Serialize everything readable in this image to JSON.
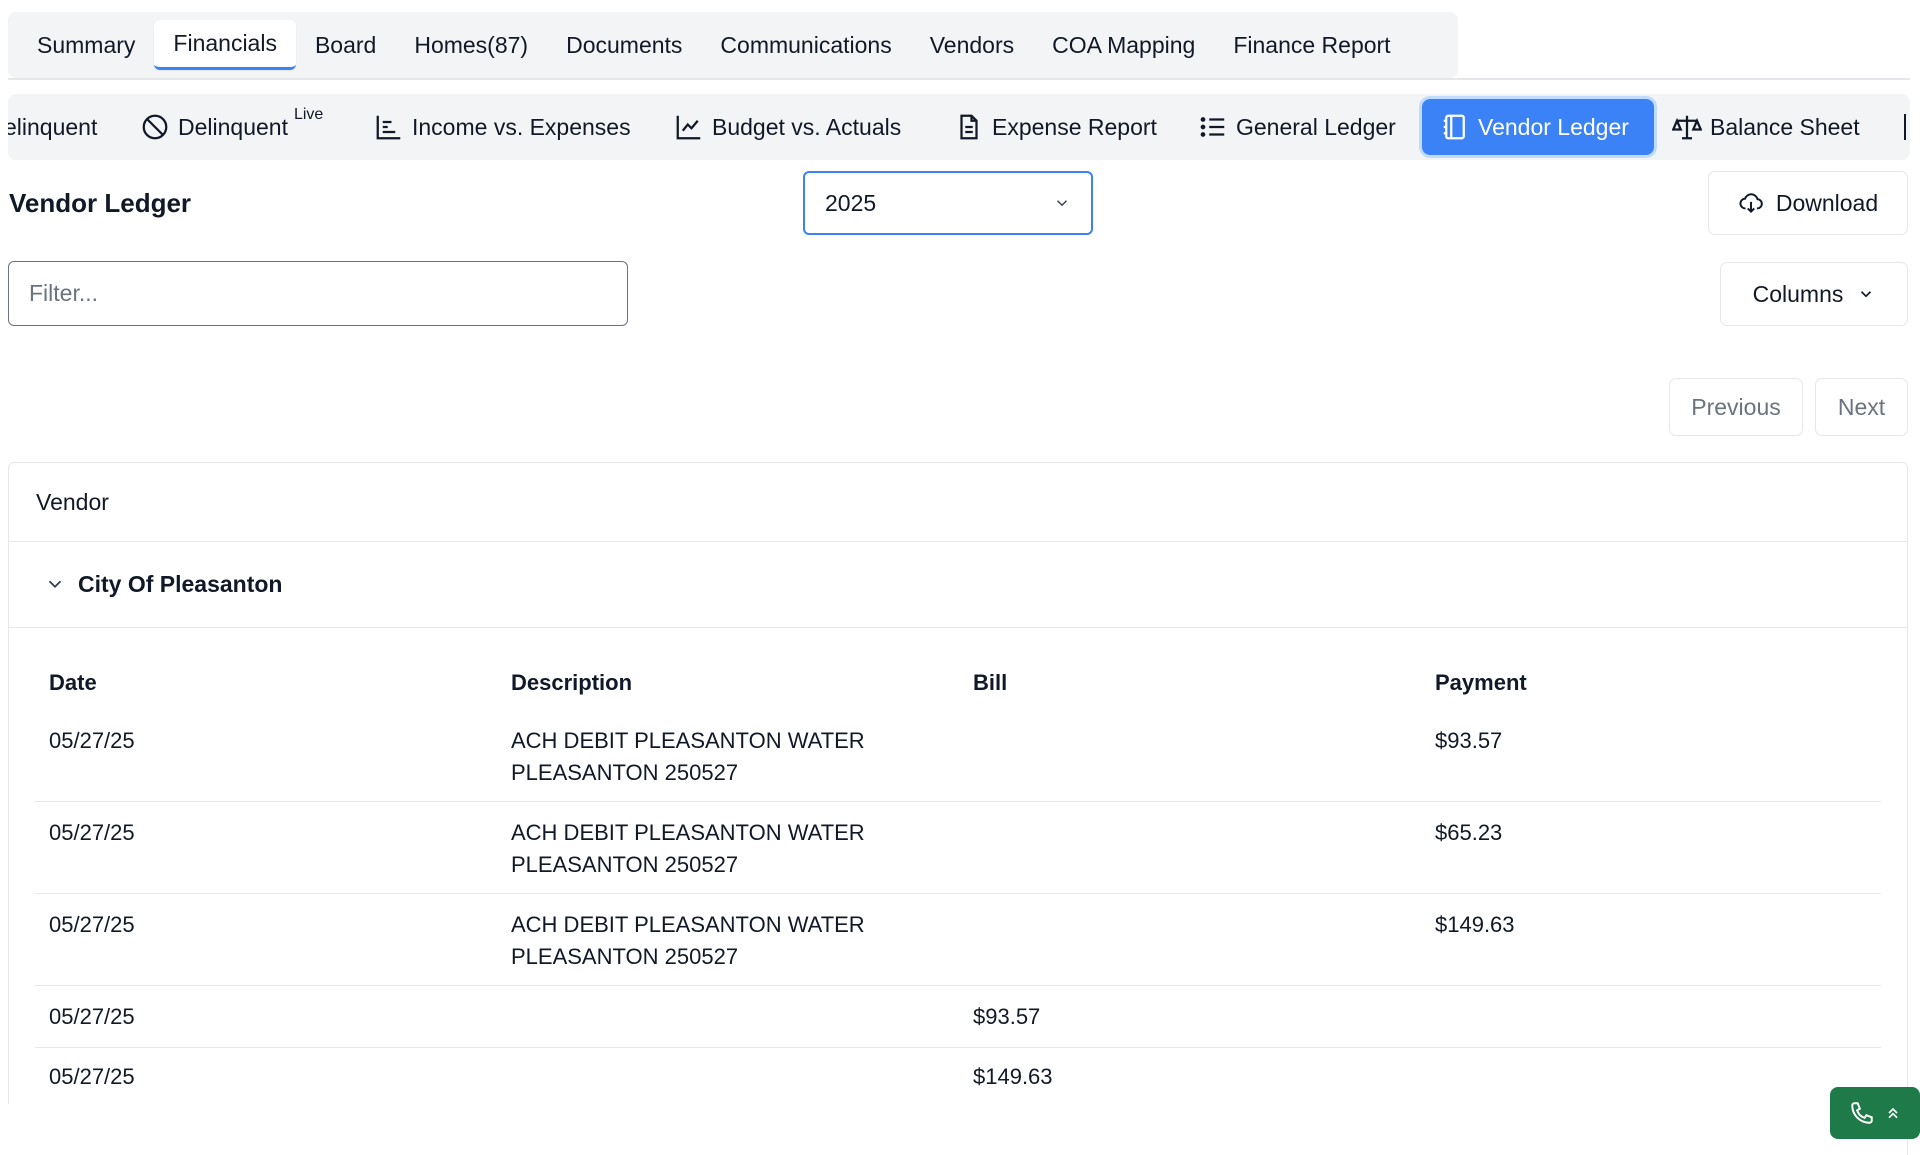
{
  "top_tabs": [
    {
      "label": "Summary"
    },
    {
      "label": "Financials",
      "active": true
    },
    {
      "label": "Board"
    },
    {
      "label": "Homes(87)"
    },
    {
      "label": "Documents"
    },
    {
      "label": "Communications"
    },
    {
      "label": "Vendors"
    },
    {
      "label": "COA Mapping"
    },
    {
      "label": "Finance Report"
    }
  ],
  "sub_tabs": {
    "delinquent_partial": "elinquent",
    "delinquent_live": "Delinquent",
    "live_badge": "Live",
    "income_expenses": "Income vs. Expenses",
    "budget_actuals": "Budget vs. Actuals",
    "expense_report": "Expense Report",
    "general_ledger": "General Ledger",
    "vendor_ledger": "Vendor Ledger",
    "balance_sheet": "Balance Sheet",
    "active": "Vendor Ledger"
  },
  "header": {
    "title": "Vendor Ledger",
    "year": "2025",
    "download_label": "Download",
    "columns_label": "Columns"
  },
  "filter": {
    "placeholder": "Filter...",
    "value": ""
  },
  "pagination": {
    "previous": "Previous",
    "next": "Next"
  },
  "table": {
    "vendor_header": "Vendor",
    "group": {
      "name": "City Of Pleasanton",
      "expanded": true
    },
    "columns": [
      "Date",
      "Description",
      "Bill",
      "Payment"
    ],
    "rows": [
      {
        "date": "05/27/25",
        "desc1": "ACH DEBIT PLEASANTON WATER",
        "desc2": "PLEASANTON 250527",
        "bill": "",
        "payment": "$93.57"
      },
      {
        "date": "05/27/25",
        "desc1": "ACH DEBIT PLEASANTON WATER",
        "desc2": "PLEASANTON 250527",
        "bill": "",
        "payment": "$65.23"
      },
      {
        "date": "05/27/25",
        "desc1": "ACH DEBIT PLEASANTON WATER",
        "desc2": "PLEASANTON 250527",
        "bill": "",
        "payment": "$149.63"
      },
      {
        "date": "05/27/25",
        "desc1": "",
        "desc2": "",
        "bill": "$93.57",
        "payment": ""
      },
      {
        "date": "05/27/25",
        "desc1": "",
        "desc2": "",
        "bill": "$149.63",
        "payment": ""
      }
    ]
  },
  "colors": {
    "accent": "#3b82f6",
    "call_widget": "#1f7a4a"
  }
}
